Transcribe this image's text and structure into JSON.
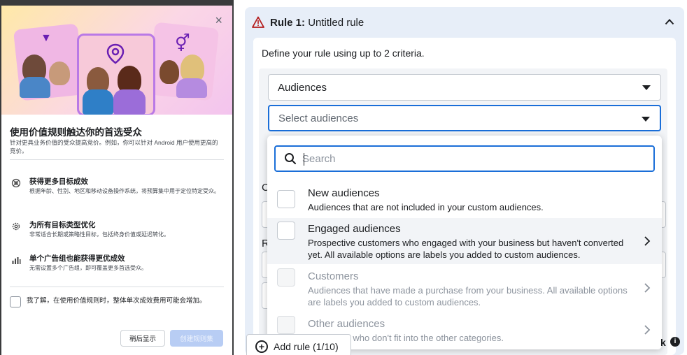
{
  "modal": {
    "close_glyph": "×",
    "title": "使用价值规则触达你的首选受众",
    "description": "针对更具业务价值的受众提高竞价。例如，你可以针对 Android 用户使用更高的竞价。",
    "features": [
      {
        "icon": "target-icon",
        "title": "获得更多目标成效",
        "desc": "根据年龄、性别、地区和移动设备操作系统，将预算集中用于定位特定受众。"
      },
      {
        "icon": "gear-icon",
        "title": "为所有目标类型优化",
        "desc": "非常适合长期或策略性目标，包括终身价值或延迟转化。"
      },
      {
        "icon": "bar-chart-icon",
        "title": "单个广告组也能获得更优成效",
        "desc": "无需设置多个广告组，即可覆盖更多首选受众。"
      }
    ],
    "acknowledge": "我了解，在使用价值规则时，整体单次成效费用可能会增加。",
    "later_button": "稍后显示",
    "create_button": "创建规则集"
  },
  "rule": {
    "title_prefix": "Rule 1:",
    "title_name": "Untitled rule",
    "define_text": "Define your rule using up to 2 criteria.",
    "criteria_select": "Audiences",
    "audience_select_placeholder": "Select audiences",
    "hidden_letters": [
      "C",
      "R"
    ]
  },
  "dropdown": {
    "search_placeholder": "Search",
    "options": [
      {
        "title": "New audiences",
        "desc": "Audiences that are not included in your custom audiences.",
        "disabled": false,
        "has_chevron": false
      },
      {
        "title": "Engaged audiences",
        "desc": "Prospective customers who engaged with your business but haven't converted yet. All available options are labels you added to custom audiences.",
        "disabled": false,
        "has_chevron": true
      },
      {
        "title": "Customers",
        "desc": "Audiences that have made a purchase from your business. All available options are labels you added to custom audiences.",
        "disabled": true,
        "has_chevron": true
      },
      {
        "title": "Other audiences",
        "desc": "Audiences who don't fit into the other categories.",
        "disabled": true,
        "has_chevron": true
      }
    ]
  },
  "footer": {
    "add_rule": "Add rule (1/10)",
    "corner_letter": "k",
    "info_glyph": "i"
  },
  "colors": {
    "accent_blue": "#1a6ed8",
    "warning_red": "#b41d1d",
    "panel_bg": "#e7eef8",
    "disabled_button": "#b8cdf4"
  }
}
